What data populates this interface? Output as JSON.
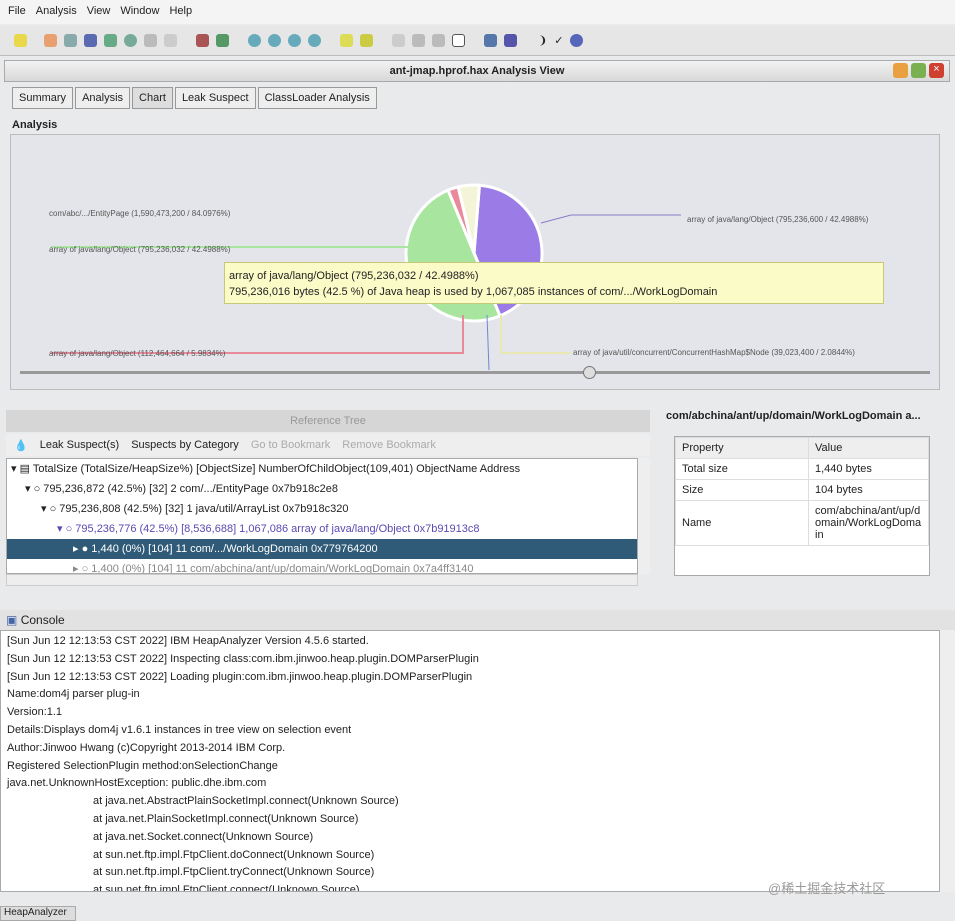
{
  "menu": [
    "File",
    "Analysis",
    "View",
    "Window",
    "Help"
  ],
  "window_title": "ant-jmap.hprof.hax Analysis View",
  "tabs": [
    "Summary",
    "Analysis",
    "Chart",
    "Leak Suspect",
    "ClassLoader Analysis"
  ],
  "active_tab": "Chart",
  "section_label": "Analysis",
  "chart": {
    "labels": {
      "left1": "com/abc/.../EntityPage (1,590,473,200 / 84.0976%)",
      "left2": "array of java/lang/Object (795,236,032 / 42.4988%)",
      "left3": "array of java/lang/Object (112,464,664 / 5.9834%)",
      "right1": "array of java/lang/Object (795,236,600 / 42.4988%)",
      "right2": "array of java/util/concurrent/ConcurrentHashMap$Node (39,023,400 / 2.0844%)"
    },
    "slices": [
      {
        "name": "purple",
        "percent": 42.5,
        "color": "#9b7be6"
      },
      {
        "name": "green",
        "percent": 50,
        "color": "#a8e6a0"
      },
      {
        "name": "red",
        "percent": 2.5,
        "color": "#e88a9a"
      },
      {
        "name": "yellow",
        "percent": 5,
        "color": "#f4f4d8"
      }
    ],
    "tooltip_title": "array of java/lang/Object (795,236,032 / 42.4988%)",
    "tooltip_body": "795,236,016 bytes (42.5 %) of Java heap is used by 1,067,085 instances of com/.../WorkLogDomain"
  },
  "reference_tree": {
    "title": "Reference Tree",
    "toolbar": {
      "leak": "Leak Suspect(s)",
      "suspects": "Suspects by Category",
      "goto": "Go to Bookmark",
      "remove": "Remove Bookmark"
    },
    "rows": [
      "TotalSize (TotalSize/HeapSize%) [ObjectSize] NumberOfChildObject(109,401) ObjectName Address",
      "795,236,872 (42.5%) [32] 2 com/.../EntityPage 0x7b918c2e8",
      "795,236,808 (42.5%) [32] 1 java/util/ArrayList 0x7b918c320",
      "795,236,776 (42.5%) [8,536,688] 1,067,086 array of java/lang/Object 0x7b91913c8",
      "1,440 (0%) [104] 11 com/.../WorkLogDomain 0x779764200",
      "1,400 (0%) [104] 11 com/abchina/ant/up/domain/WorkLogDomain 0x7a4ff3140"
    ]
  },
  "properties": {
    "title": "com/abchina/ant/up/domain/WorkLogDomain a...",
    "headers": [
      "Property",
      "Value"
    ],
    "rows": [
      [
        "Total size",
        "1,440 bytes"
      ],
      [
        "Size",
        "104 bytes"
      ],
      [
        "Name",
        "com/abchina/ant/up/domain/WorkLogDomain"
      ]
    ]
  },
  "console": {
    "title": "Console",
    "lines": [
      "[Sun Jun 12 12:13:53 CST 2022] IBM HeapAnalyzer Version 4.5.6 started.",
      "[Sun Jun 12 12:13:53 CST 2022] Inspecting class:com.ibm.jinwoo.heap.plugin.DOMParserPlugin",
      "[Sun Jun 12 12:13:53 CST 2022] Loading plugin:com.ibm.jinwoo.heap.plugin.DOMParserPlugin",
      "Name:dom4j parser plug-in",
      "Version:1.1",
      "Details:Displays dom4j v1.6.1 instances in tree view on selection event",
      "Author:Jinwoo Hwang (c)Copyright 2013-2014 IBM Corp.",
      "Registered SelectionPlugin method:onSelectionChange",
      "java.net.UnknownHostException: public.dhe.ibm.com"
    ],
    "stack": [
      "at java.net.AbstractPlainSocketImpl.connect(Unknown Source)",
      "at java.net.PlainSocketImpl.connect(Unknown Source)",
      "at java.net.Socket.connect(Unknown Source)",
      "at sun.net.ftp.impl.FtpClient.doConnect(Unknown Source)",
      "at sun.net.ftp.impl.FtpClient.tryConnect(Unknown Source)",
      "at sun.net.ftp.impl.FtpClient.connect(Unknown Source)"
    ]
  },
  "status": "HeapAnalyzer",
  "watermark": "@稀土掘金技术社区"
}
